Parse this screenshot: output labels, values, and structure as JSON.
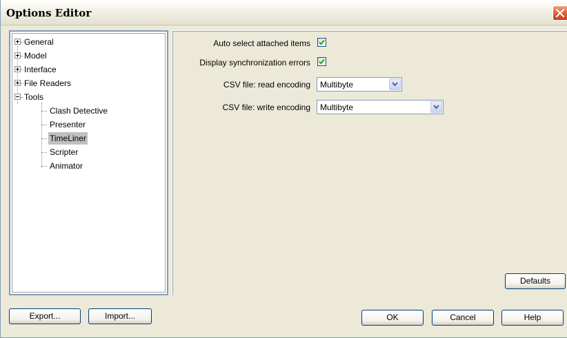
{
  "window": {
    "title": "Options Editor"
  },
  "tree": {
    "items": [
      {
        "label": "General",
        "expander": "plus"
      },
      {
        "label": "Model",
        "expander": "plus"
      },
      {
        "label": "Interface",
        "expander": "plus"
      },
      {
        "label": "File Readers",
        "expander": "plus"
      },
      {
        "label": "Tools",
        "expander": "minus"
      }
    ],
    "tools_children": [
      {
        "label": "Clash Detective"
      },
      {
        "label": "Presenter"
      },
      {
        "label": "TimeLiner",
        "selected": true
      },
      {
        "label": "Scripter"
      },
      {
        "label": "Animator"
      }
    ]
  },
  "options": {
    "auto_select_label": "Auto select attached items",
    "auto_select_checked": true,
    "display_sync_label": "Display synchronization errors",
    "display_sync_checked": true,
    "csv_read_label": "CSV file: read encoding",
    "csv_read_value": "Multibyte",
    "csv_write_label": "CSV file: write encoding",
    "csv_write_value": "Multibyte"
  },
  "buttons": {
    "defaults": "Defaults",
    "export": "Export...",
    "import": "Import...",
    "ok": "OK",
    "cancel": "Cancel",
    "help": "Help"
  },
  "icons": {
    "close": "close-icon",
    "check": "check-icon",
    "dropdown": "chevron-down-icon",
    "expand": "plus-icon",
    "collapse": "minus-icon"
  },
  "colors": {
    "dialog_bg": "#ece9d8",
    "close_red": "#e0603a",
    "check_green": "#21a121",
    "selection": "#c0c0c0"
  }
}
